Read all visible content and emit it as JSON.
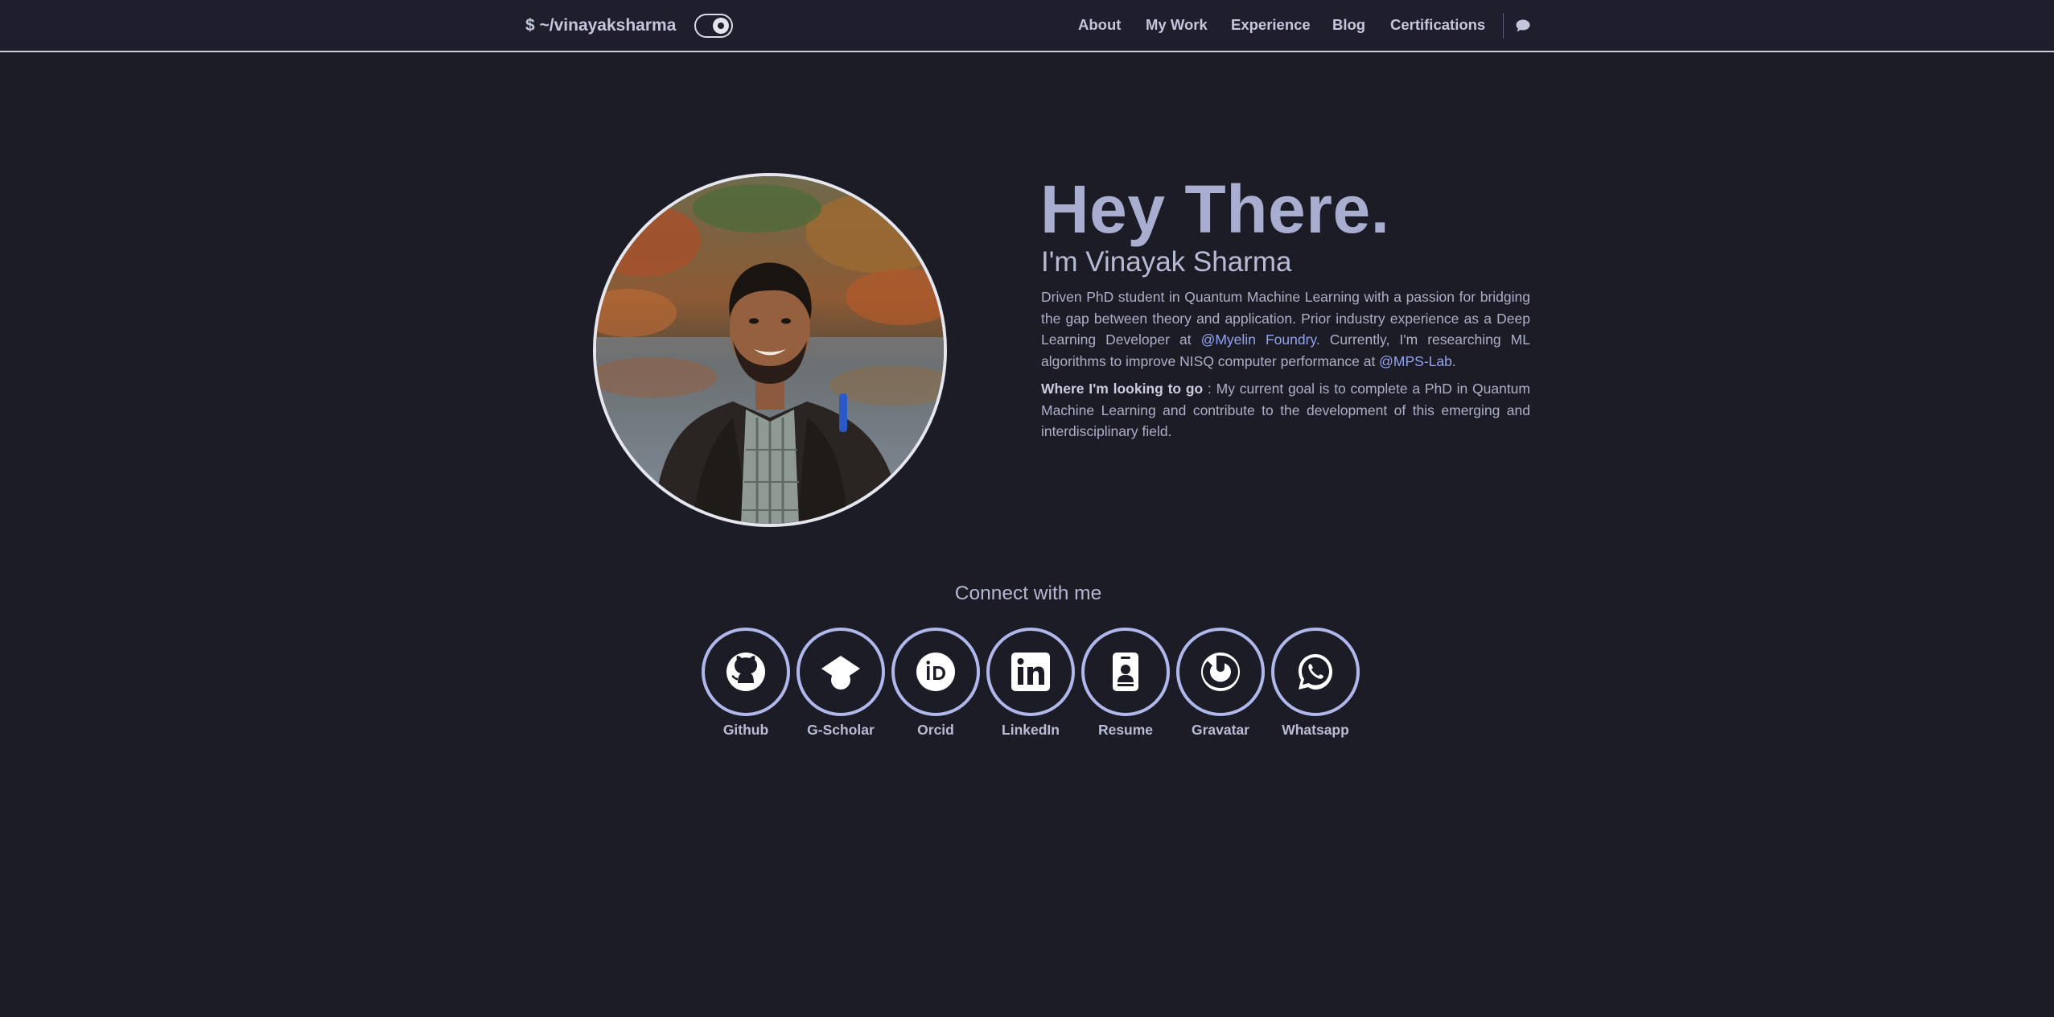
{
  "nav": {
    "brand": "$ ~/vinayaksharma",
    "links": [
      "About",
      "My Work",
      "Experience",
      "Blog",
      "Certifications"
    ]
  },
  "icons": {
    "theme_toggle": "theme-toggle-icon",
    "chat": "chat-bubble-icon"
  },
  "hero": {
    "greeting": "Hey There.",
    "name": "I'm Vinayak Sharma",
    "bio_part1": "Driven PhD student in Quantum Machine Learning with a passion for bridging the gap between theory and application. Prior industry experience as a Deep Learning Developer at ",
    "bio_link1": "@Myelin Foundry",
    "bio_part2": ". Currently, I'm researching ML algorithms to improve NISQ computer performance at ",
    "bio_link2": "@MPS-Lab",
    "bio_part3": ".",
    "goal_label": "Where I'm looking to go",
    "goal_text": " : My current goal is to complete a PhD in Quantum Machine Learning and contribute to the development of this emerging and interdisciplinary field."
  },
  "connect": {
    "title": "Connect with me",
    "links": [
      {
        "label": "Github",
        "icon": "github-icon"
      },
      {
        "label": "G-Scholar",
        "icon": "graduation-cap-icon"
      },
      {
        "label": "Orcid",
        "icon": "orcid-icon"
      },
      {
        "label": "LinkedIn",
        "icon": "linkedin-icon"
      },
      {
        "label": "Resume",
        "icon": "id-badge-icon"
      },
      {
        "label": "Gravatar",
        "icon": "gravatar-icon"
      },
      {
        "label": "Whatsapp",
        "icon": "whatsapp-icon"
      }
    ]
  },
  "colors": {
    "background": "#1c1c27",
    "accent": "#93a4ee",
    "ring": "#b0b7ea"
  }
}
